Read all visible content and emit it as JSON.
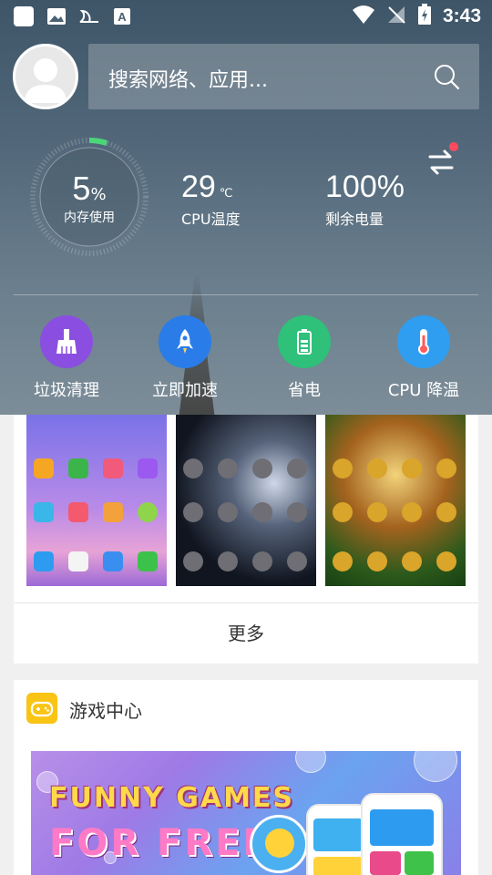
{
  "statusbar": {
    "time": "3:43"
  },
  "search": {
    "placeholder": "搜索网络、应用..."
  },
  "gauge": {
    "value": "5",
    "unit": "%",
    "label": "内存使用",
    "level": 5
  },
  "cpu": {
    "value": "29",
    "unit": "℃",
    "label": "CPU温度"
  },
  "battery": {
    "value": "100%",
    "label": "剩余电量"
  },
  "tools": [
    {
      "label": "垃圾清理",
      "color": "#8a4fe0",
      "icon": "broom-icon"
    },
    {
      "label": "立即加速",
      "color": "#2a7de8",
      "icon": "rocket-icon"
    },
    {
      "label": "省电",
      "color": "#2fc07a",
      "icon": "battery-icon"
    },
    {
      "label": "CPU 降温",
      "color": "#2f9ef0",
      "icon": "thermometer-icon"
    }
  ],
  "themes": {
    "more_label": "更多",
    "thumbs": [
      "theme-purple-mountain",
      "theme-soccer-dark",
      "theme-golden-cup"
    ]
  },
  "game_center": {
    "title": "游戏中心"
  },
  "banner": {
    "line1": "FUNNY GAMES",
    "line2": "FOR FREE"
  }
}
